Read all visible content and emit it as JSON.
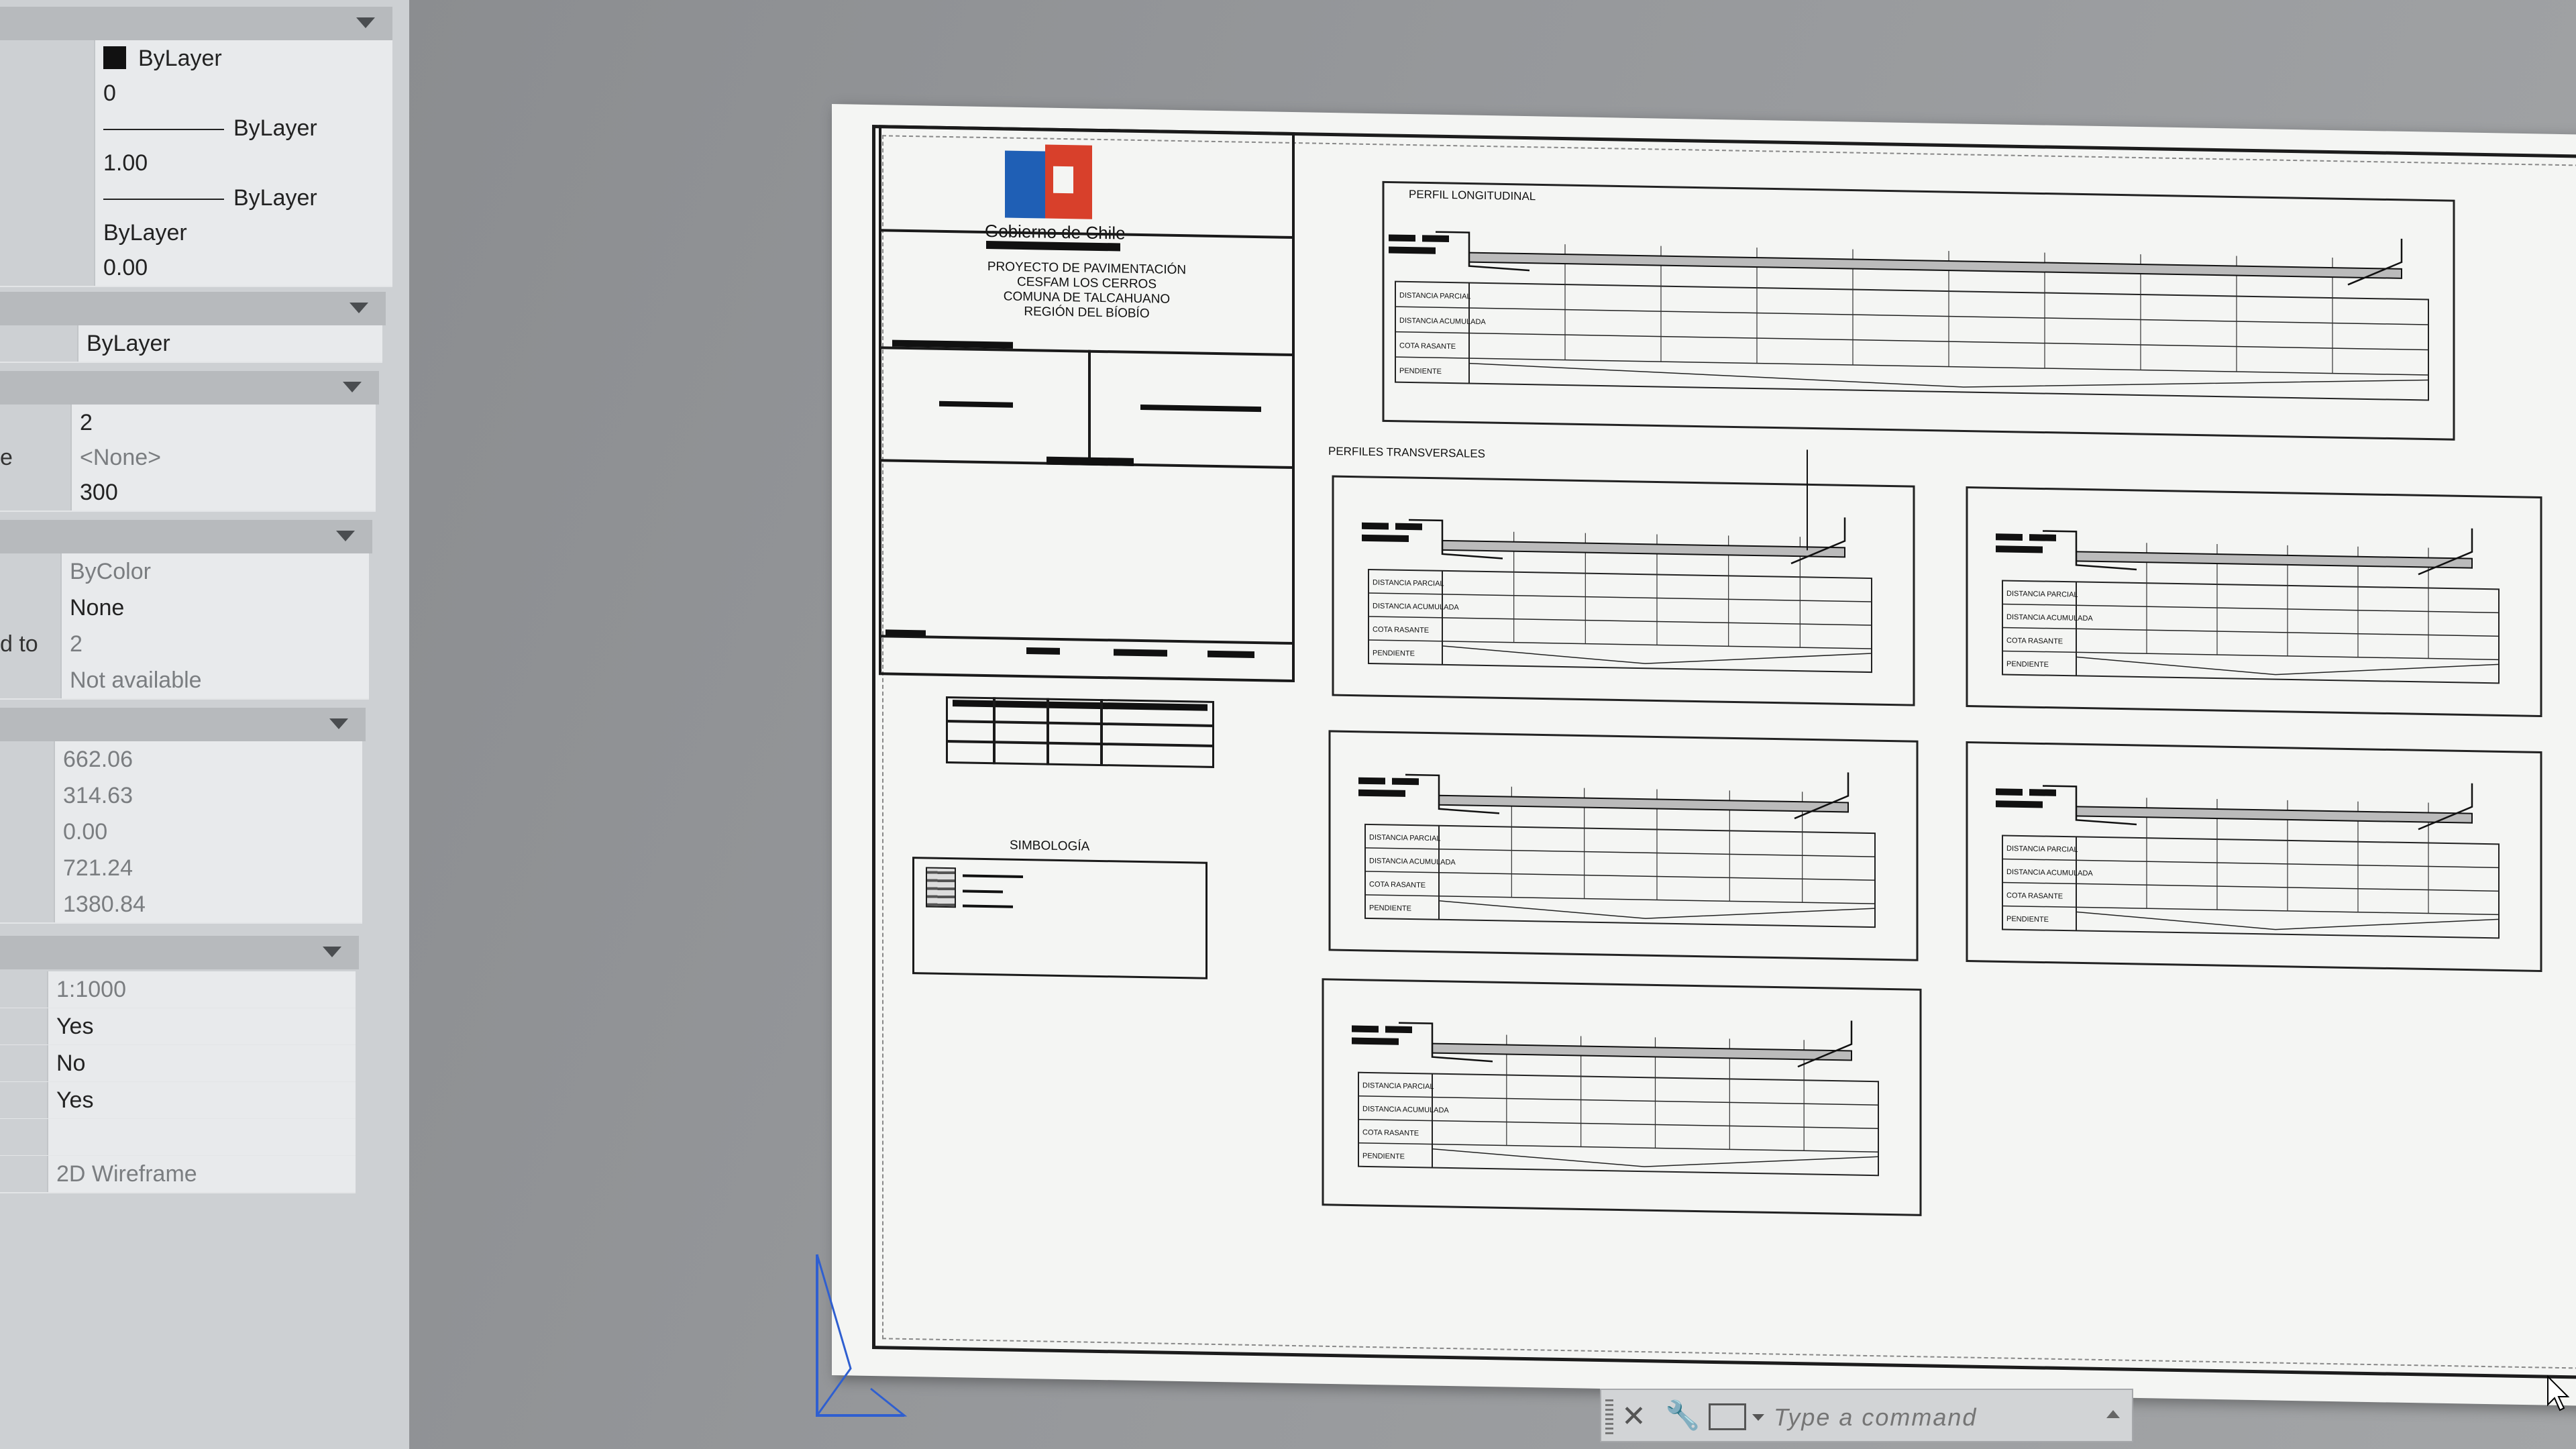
{
  "properties": {
    "general": {
      "rows": [
        {
          "label": "",
          "value": "ByLayer",
          "swatch": true
        },
        {
          "label": "",
          "value": "0"
        },
        {
          "label": "",
          "value": "ByLayer",
          "linetype": true
        },
        {
          "label": "",
          "value": "1.00"
        },
        {
          "label": "",
          "value": "ByLayer",
          "linetype": true
        },
        {
          "label": "",
          "value": "ByLayer"
        },
        {
          "label": "",
          "value": "0.00"
        }
      ]
    },
    "three_d": {
      "rows": [
        {
          "label": "",
          "value": "ByLayer"
        }
      ]
    },
    "plot": {
      "rows": [
        {
          "label": "",
          "value": "2"
        },
        {
          "label": "e",
          "value": "<None>",
          "dim": true
        },
        {
          "label": "",
          "value": "300"
        }
      ]
    },
    "plot2": {
      "rows": [
        {
          "label": "",
          "value": "ByColor",
          "dim": true
        },
        {
          "label": "",
          "value": "None"
        },
        {
          "label": "d to",
          "value": "2",
          "dim": true
        },
        {
          "label": "",
          "value": "Not available",
          "dim": true
        }
      ]
    },
    "view": {
      "rows": [
        {
          "label": "",
          "value": "662.06",
          "dim": true
        },
        {
          "label": "",
          "value": "314.63",
          "dim": true
        },
        {
          "label": "",
          "value": "0.00",
          "dim": true
        },
        {
          "label": "",
          "value": "721.24",
          "dim": true
        },
        {
          "label": "",
          "value": "1380.84",
          "dim": true
        }
      ]
    },
    "misc": {
      "rows": [
        {
          "label": "",
          "value": "1:1000",
          "dim": true
        },
        {
          "label": "",
          "value": "Yes"
        },
        {
          "label": "",
          "value": "No"
        },
        {
          "label": "",
          "value": "Yes"
        },
        {
          "label": "",
          "value": ""
        },
        {
          "label": "",
          "value": "2D Wireframe",
          "dim": true
        }
      ]
    }
  },
  "sheet": {
    "logo_text": "Gobierno de Chile",
    "project_lines": [
      "PROYECTO DE PAVIMENTACIÓN",
      "CESFAM LOS CERROS",
      "COMUNA DE TALCAHUANO",
      "REGIÓN DEL BÍOBÍO"
    ],
    "symbology_title": "SIMBOLOGÍA",
    "longitudinal_title": "PERFIL LONGITUDINAL",
    "transversal_title": "PERFILES TRANSVERSALES",
    "row_labels": [
      "DISTANCIA PARCIAL",
      "DISTANCIA ACUMULADA",
      "COTA RASANTE",
      "PENDIENTE"
    ]
  },
  "command_line": {
    "placeholder": "Type a command"
  },
  "colors": {
    "palette_bg": "#cdd0d3",
    "canvas_bg": "#8d8f91",
    "logo_blue": "#1f5fb5",
    "logo_red": "#d8402b",
    "ucs_blue": "#2f5fd0"
  }
}
